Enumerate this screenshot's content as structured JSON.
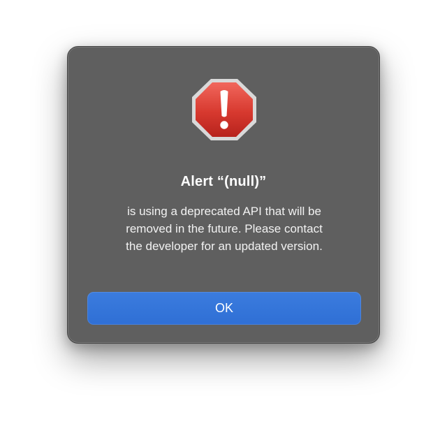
{
  "dialog": {
    "title": "Alert “(null)”",
    "message_lines": [
      "is using a deprecated API that will be",
      "removed in the future. Please contact",
      "the developer for an updated version."
    ],
    "button_label": "OK",
    "icon": "alert-icon",
    "colors": {
      "dialog_background": "#5f5f5f",
      "button_background": "#3272d8",
      "alert_red": "#d7392f",
      "text": "#ffffff"
    }
  }
}
